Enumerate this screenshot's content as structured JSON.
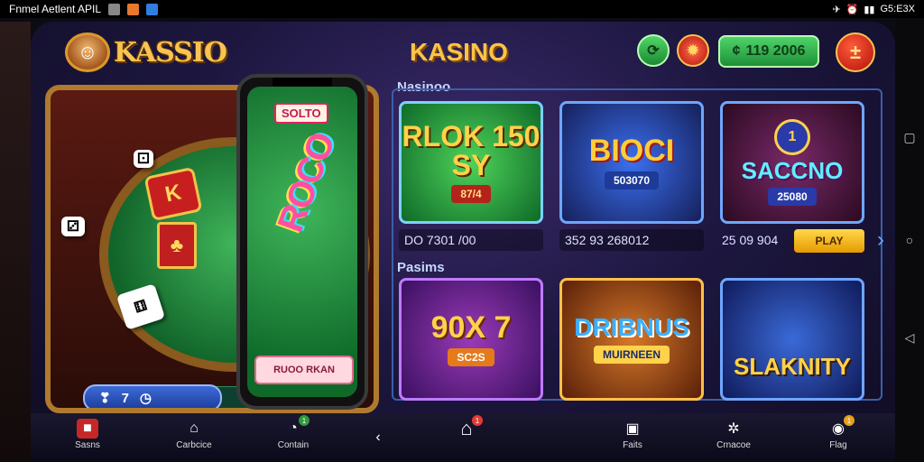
{
  "status_bar": {
    "left_text": "Fnmel Aetlent APIL",
    "right_text": "G5:E3X"
  },
  "header": {
    "logo_text": "KASSIO",
    "title": "KASINO",
    "coins_value": "119 2006",
    "refresh_icon": "refresh-icon",
    "settings_icon": "gear-icon",
    "menu_icon": "plus-icon"
  },
  "table": {
    "pill_count": "7"
  },
  "phone": {
    "tag": "SOLTO",
    "logo": "ROCO",
    "button_label": "RUOO RKAN"
  },
  "sections": {
    "top_label": "Nasinoo",
    "bottom_label": "Pasims"
  },
  "cards_top": [
    {
      "title": "RLOK 150 SY",
      "sub": "87/4",
      "meta": "DO 7301 /00"
    },
    {
      "title": "BIOCI",
      "sub": "503070",
      "meta": "352 93 268012"
    },
    {
      "title": "SACCNO",
      "sub": "25080",
      "meta": "25 09 904",
      "action": "PLAY",
      "badge": "1"
    }
  ],
  "cards_bottom": [
    {
      "title": "90X 7",
      "sub": "SC2S"
    },
    {
      "title": "DRIBNUS",
      "sub": "MUIRNEEN"
    },
    {
      "title": "SLAKNITY",
      "sub": ""
    }
  ],
  "bottom_nav": [
    {
      "label": "Sasns",
      "icon": "gift-icon"
    },
    {
      "label": "Carbcice",
      "icon": "home-icon"
    },
    {
      "label": "Contain",
      "icon": "chat-icon",
      "badge": "1"
    },
    {
      "label": "",
      "icon": "back-arrow-icon"
    },
    {
      "label": "",
      "icon": "house-icon",
      "badge": "1"
    },
    {
      "label": "Faits",
      "icon": "bag-icon"
    },
    {
      "label": "Crnacoe",
      "icon": "gear-icon"
    },
    {
      "label": "Flag",
      "icon": "controller-icon",
      "badge": "1"
    }
  ],
  "colors": {
    "accent_gold": "#f7c451",
    "coins_green": "#1e8f37",
    "menu_red": "#b1120a",
    "frame_blue": "#3b5fa8"
  }
}
